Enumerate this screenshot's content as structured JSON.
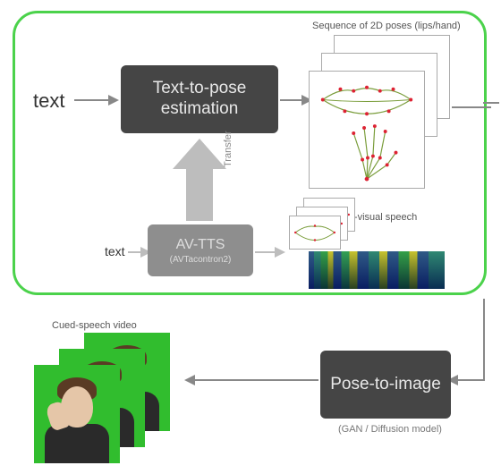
{
  "top": {
    "outline_color": "#4bd24b",
    "input_main": "text",
    "input_small": "text",
    "t2p_label": "Text-to-pose estimation",
    "avtts_label": "AV-TTS",
    "avtts_sub": "(AVTacontron2)",
    "transfer_label": "Transfer",
    "pose_annot": "Sequence of 2D poses (lips/hand)",
    "av_annot": "audio-visual speech"
  },
  "bottom": {
    "p2i_label": "Pose-to-image",
    "p2i_sub": "(GAN / Diffusion model)",
    "video_annot": "Cued-speech video"
  },
  "chart_data": {
    "type": "diagram",
    "flow": [
      {
        "from": "text",
        "to": "Text-to-pose estimation",
        "style": "arrow"
      },
      {
        "from": "Text-to-pose estimation",
        "to": "Sequence of 2D poses (lips/hand)",
        "style": "arrow"
      },
      {
        "from": "text",
        "to": "AV-TTS (AVTacontron2)",
        "style": "arrow-light"
      },
      {
        "from": "AV-TTS (AVTacontron2)",
        "to": "audio-visual speech",
        "style": "arrow-light"
      },
      {
        "from": "AV-TTS (AVTacontron2)",
        "to": "Text-to-pose estimation",
        "style": "big-arrow",
        "label": "Transfer"
      },
      {
        "from": "Sequence of 2D poses (lips/hand)",
        "to": "Pose-to-image (GAN / Diffusion model)",
        "style": "arrow"
      },
      {
        "from": "Pose-to-image (GAN / Diffusion model)",
        "to": "Cued-speech video",
        "style": "arrow"
      }
    ],
    "grouped_region": [
      "text",
      "Text-to-pose estimation",
      "AV-TTS",
      "Sequence of 2D poses",
      "audio-visual speech"
    ]
  }
}
